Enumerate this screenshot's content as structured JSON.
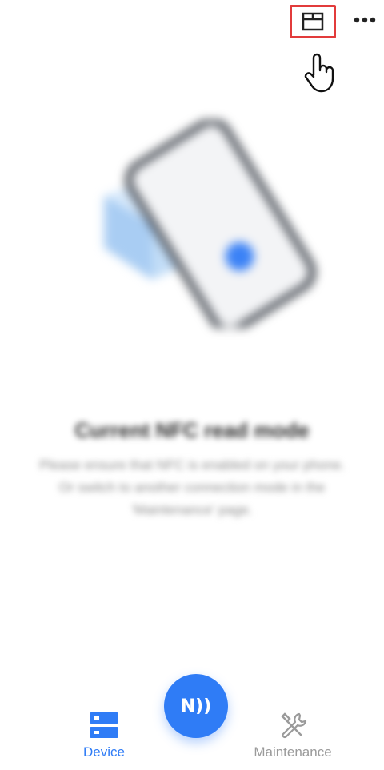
{
  "header": {
    "folder_icon": "folder-icon",
    "more_icon": "more-horizontal-icon",
    "highlight_color": "#e23b3b"
  },
  "hero": {
    "image_icon": "nfc-phone-illustration"
  },
  "mode": {
    "title": "Current NFC read mode",
    "description": "Please ensure that NFC is enabled on your phone.\nOr switch to another connection mode in the 'Maintenance' page."
  },
  "nfc_button": {
    "label": "N))",
    "color": "#2f7cf6"
  },
  "tabs": [
    {
      "label": "Device",
      "icon": "device-server-icon",
      "active": true
    },
    {
      "label": "Maintenance",
      "icon": "tools-icon",
      "active": false
    }
  ],
  "colors": {
    "accent": "#2f7cf6",
    "inactive": "#9a9a9a"
  }
}
